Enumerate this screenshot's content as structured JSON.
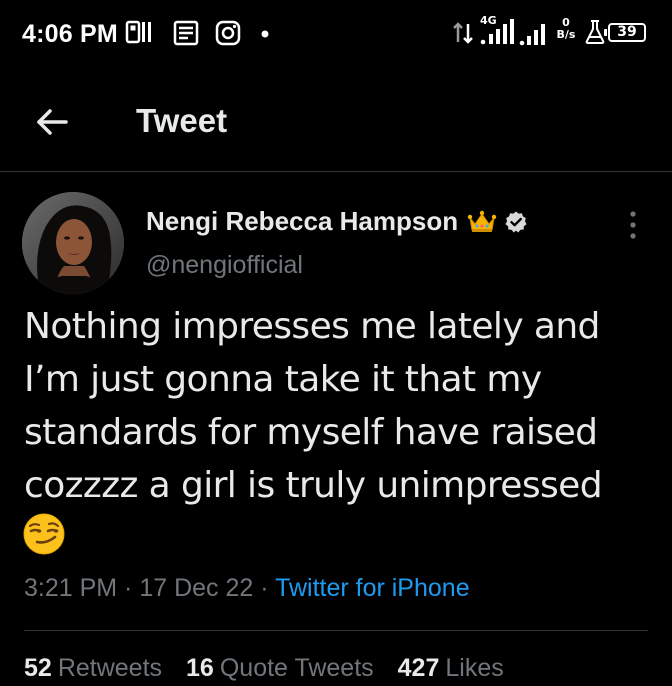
{
  "status_bar": {
    "time": "4:06 PM",
    "network_type": "4G",
    "speed_value": "0",
    "speed_unit": "B/s",
    "battery": "39"
  },
  "header": {
    "title": "Tweet"
  },
  "tweet": {
    "author_name": "Nengi Rebecca Hampson",
    "handle": "@nengiofficial",
    "text": "Nothing impresses me lately and\nI’m just gonna take it that my\nstandards for myself have raised\ncozzzz a girl is truly unimpressed",
    "emoji": "smirking-face-emoji",
    "time": "3:21 PM",
    "separator": " · ",
    "date": "17 Dec 22",
    "source": "Twitter for iPhone"
  },
  "stats": [
    {
      "count": "52",
      "label": "Retweets"
    },
    {
      "count": "16",
      "label": "Quote Tweets"
    },
    {
      "count": "427",
      "label": "Likes"
    }
  ],
  "colors": {
    "background": "#000000",
    "text": "#e7e9ea",
    "secondary": "#71767b",
    "accent": "#1d9bf0",
    "divider": "#2f3336"
  },
  "icons": {
    "back": "arrow-left-icon",
    "more": "more-vertical-icon",
    "verified": "verified-badge-icon",
    "crown": "crown-icon"
  }
}
